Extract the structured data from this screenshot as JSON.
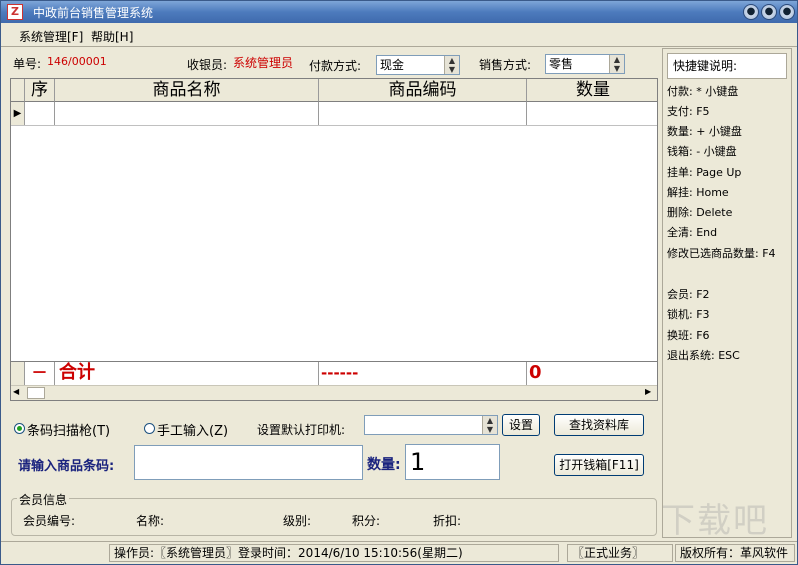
{
  "window": {
    "title": "中政前台销售管理系统",
    "app_icon_glyph": "Z",
    "min_glyph": "●",
    "restore_glyph": "●",
    "close_glyph": "●"
  },
  "menu": {
    "items": [
      "系统管理[F]",
      "帮助[H]"
    ]
  },
  "order": {
    "number_label": "单号:",
    "number_value": "146/00001",
    "cashier_label": "收银员:",
    "cashier_value": "系统管理员",
    "payment_label": "付款方式:",
    "payment_value": "现金",
    "sale_label": "销售方式:",
    "sale_value": "零售"
  },
  "table": {
    "columns": [
      "序",
      "商品名称",
      "商品编码",
      "数量"
    ],
    "total_minus": "－",
    "total_label": "合计",
    "total_code": "------",
    "total_qty": "0",
    "row_pointer": "▶"
  },
  "input_mode": {
    "scanner_label": "条码扫描枪(T)",
    "manual_label": "手工输入(Z)",
    "printer_label": "设置默认打印机:",
    "printer_value": "",
    "set_button": "设置",
    "search_button": "查找资料库",
    "open_drawer_button": "打开钱箱[F11]",
    "barcode_label": "请输入商品条码:",
    "barcode_value": "",
    "qty_label": "数量:",
    "qty_value": "1"
  },
  "member": {
    "group_title": "会员信息",
    "id_label": "会员编号:",
    "name_label": "名称:",
    "level_label": "级别:",
    "points_label": "积分:",
    "discount_label": "折扣:"
  },
  "shortcuts": {
    "header": "快捷键说明:",
    "lines": [
      "付款:  * 小键盘",
      "支付:  F5",
      "数量:  + 小键盘",
      "钱箱:  - 小键盘",
      "挂单:  Page Up",
      "解挂:  Home",
      "删除:  Delete",
      "全清:  End",
      "修改已选商品数量: F4",
      "会员:  F2",
      "锁机:  F3",
      "换班:  F6",
      "退出系统: ESC"
    ]
  },
  "status": {
    "operator": "操作员:〖系统管理员〗登录时间：2014/6/10  15:10:56(星期二)",
    "mode": "〖正式业务〗",
    "copyright": "版权所有：革风软件"
  },
  "watermark": "下载吧"
}
